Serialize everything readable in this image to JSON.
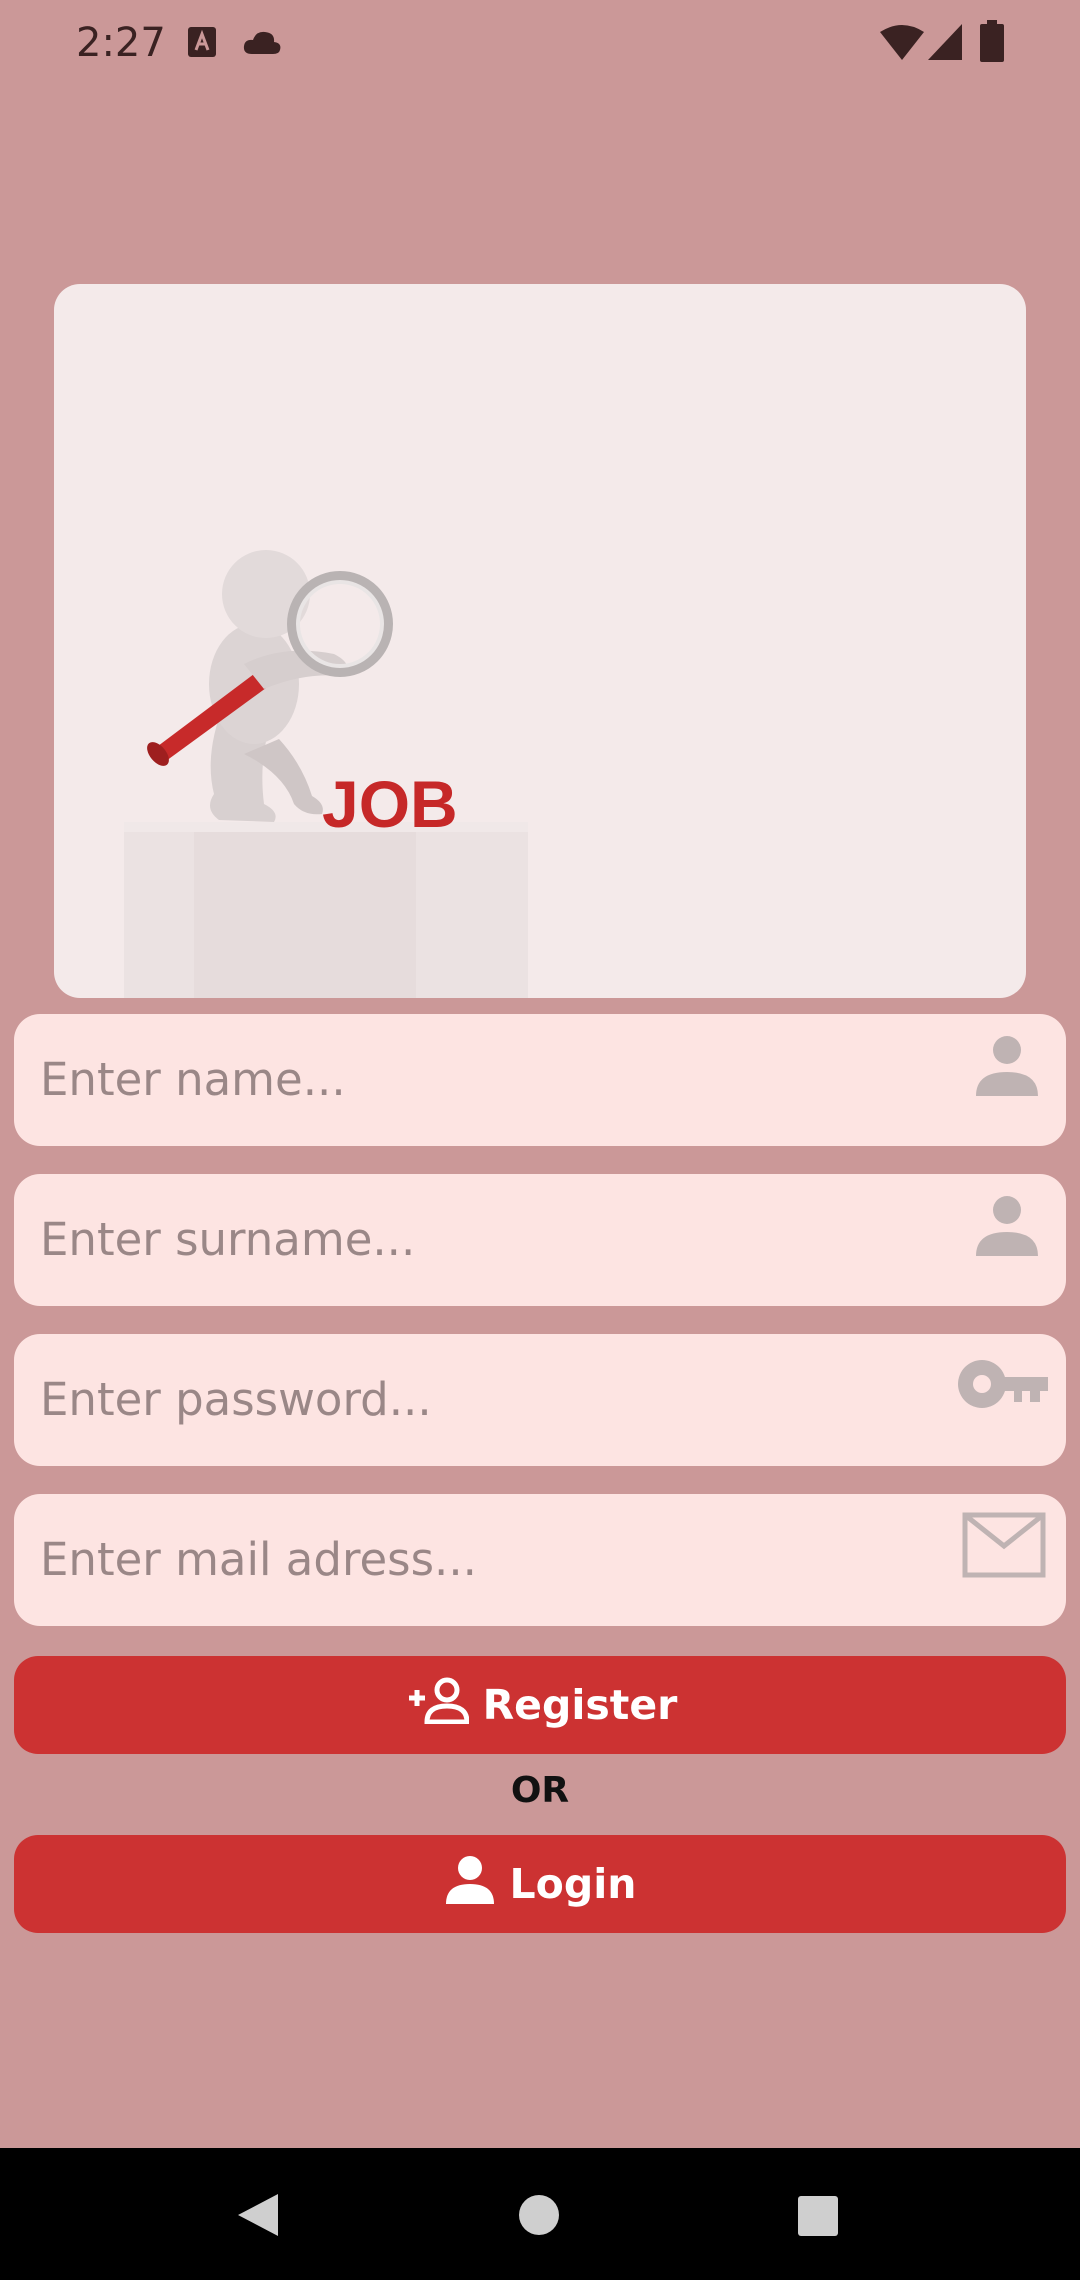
{
  "status_bar": {
    "time": "2:27",
    "icons": [
      "text-a-icon",
      "cloud-icon",
      "wifi-icon",
      "signal-icon",
      "battery-icon"
    ]
  },
  "hero": {
    "job_label": "JOB",
    "illustration": "figure-with-magnifier"
  },
  "form": {
    "name_placeholder": "Enter name...",
    "surname_placeholder": "Enter surname...",
    "password_placeholder": "Enter password...",
    "mail_placeholder": "Enter mail adress...",
    "name_icon": "person-icon",
    "surname_icon": "person-icon",
    "password_icon": "key-icon",
    "mail_icon": "mail-icon"
  },
  "actions": {
    "register_label": "Register",
    "or_label": "OR",
    "login_label": "Login"
  },
  "colors": {
    "background": "#cb9898",
    "card": "#f4eaea",
    "field": "#fde4e2",
    "accent": "#cc3232"
  }
}
